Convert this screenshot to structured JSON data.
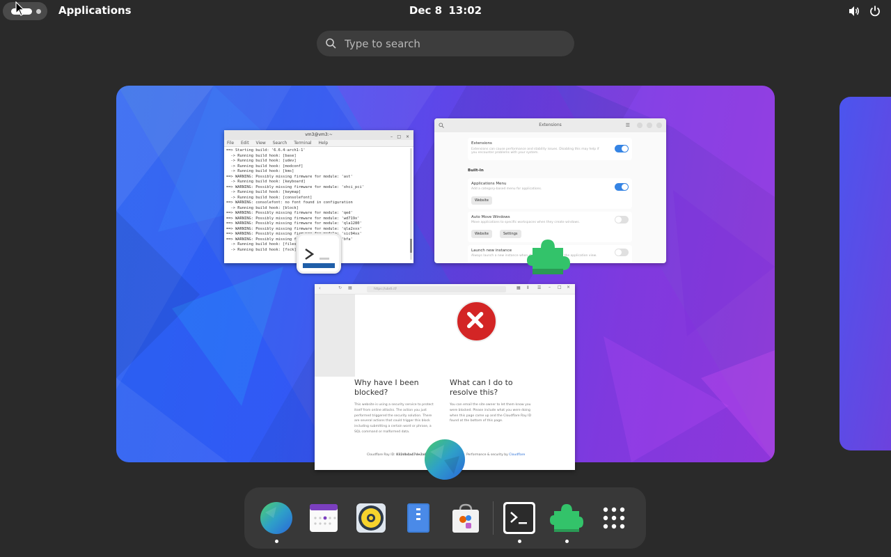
{
  "topbar": {
    "app_menu": "Applications",
    "date": "Dec 8",
    "time": "13:02"
  },
  "search": {
    "placeholder": "Type to search"
  },
  "windows": {
    "terminal": {
      "title": "vm3@vm3:~",
      "menu": [
        "File",
        "Edit",
        "View",
        "Search",
        "Terminal",
        "Help"
      ],
      "lines": [
        "==> Starting build: '6.6.4-arch1-1'",
        "  -> Running build hook: [base]",
        "  -> Running build hook: [udev]",
        "  -> Running build hook: [modconf]",
        "  -> Running build hook: [kms]",
        "==> WARNING: Possibly missing firmware for module: 'ast'",
        "  -> Running build hook: [keyboard]",
        "==> WARNING: Possibly missing firmware for module: 'xhci_pci'",
        "  -> Running build hook: [keymap]",
        "  -> Running build hook: [consolefont]",
        "==> WARNING: consolefont: no font found in configuration",
        "  -> Running build hook: [block]",
        "==> WARNING: Possibly missing firmware for module: 'qed'",
        "==> WARNING: Possibly missing firmware for module: 'wd719x'",
        "==> WARNING: Possibly missing firmware for module: 'qla1280'",
        "==> WARNING: Possibly missing firmware for module: 'qla2xxx'",
        "==> WARNING: Possibly missing firmware for module: 'sic94xx'",
        "==> WARNING: Possibly missing firmware for module: 'bfa'",
        "  -> Running build hook: [filesystems]",
        "  -> Running build hook: [fsck]"
      ]
    },
    "extensions": {
      "title": "Extensions",
      "main_toggle_title": "Extensions",
      "main_toggle_desc": "Extensions can cause performance and stability issues. Disabling this may help if you encounter problems with your system.",
      "section": "Built-In",
      "items": [
        {
          "name": "Applications Menu",
          "desc": "Add a category-based menu for applications.",
          "buttons": [
            "Website"
          ],
          "enabled": true
        },
        {
          "name": "Auto Move Windows",
          "desc": "Move applications to specific workspaces when they create windows.",
          "buttons": [
            "Website",
            "Settings"
          ],
          "enabled": false
        },
        {
          "name": "Launch new instance",
          "desc": "Always launch a new instance when clicking in the dash or the application view.",
          "buttons": [],
          "enabled": false
        }
      ]
    },
    "browser": {
      "url": "https://ubdl.cf/",
      "heading_left": "Why have I been blocked?",
      "text_left": "This website is using a security service to protect itself from online attacks. The action you just performed triggered the security solution. There are several actions that could trigger this block including submitting a certain word or phrase, a SQL command or malformed data.",
      "heading_right": "What can I do to resolve this?",
      "text_right": "You can email the site owner to let them know you were blocked. Please include what you were doing when this page came up and the Cloudflare Ray ID found at the bottom of this page.",
      "ray_label": "Cloudflare Ray ID:",
      "ray_id": "832db4a47de2a8f",
      "perf_label": "Performance & security by",
      "perf_brand": "Cloudflare"
    }
  },
  "dash": {
    "items": [
      {
        "name": "Web",
        "icon": "web-browser-icon",
        "running": true
      },
      {
        "name": "Calendar",
        "icon": "calendar-icon",
        "running": false
      },
      {
        "name": "Rhythmbox",
        "icon": "music-player-icon",
        "running": false
      },
      {
        "name": "Files",
        "icon": "files-icon",
        "running": false
      },
      {
        "name": "Software",
        "icon": "software-store-icon",
        "running": false
      },
      {
        "name": "Terminal",
        "icon": "terminal-icon",
        "running": true
      },
      {
        "name": "Extensions",
        "icon": "extensions-icon",
        "running": true
      },
      {
        "name": "Show Apps",
        "icon": "app-grid-icon",
        "running": false
      }
    ]
  },
  "colors": {
    "accent": "#3584e4",
    "panel_bg": "#2a2a2a",
    "dash_bg": "#383838",
    "block_red": "#d32525"
  }
}
